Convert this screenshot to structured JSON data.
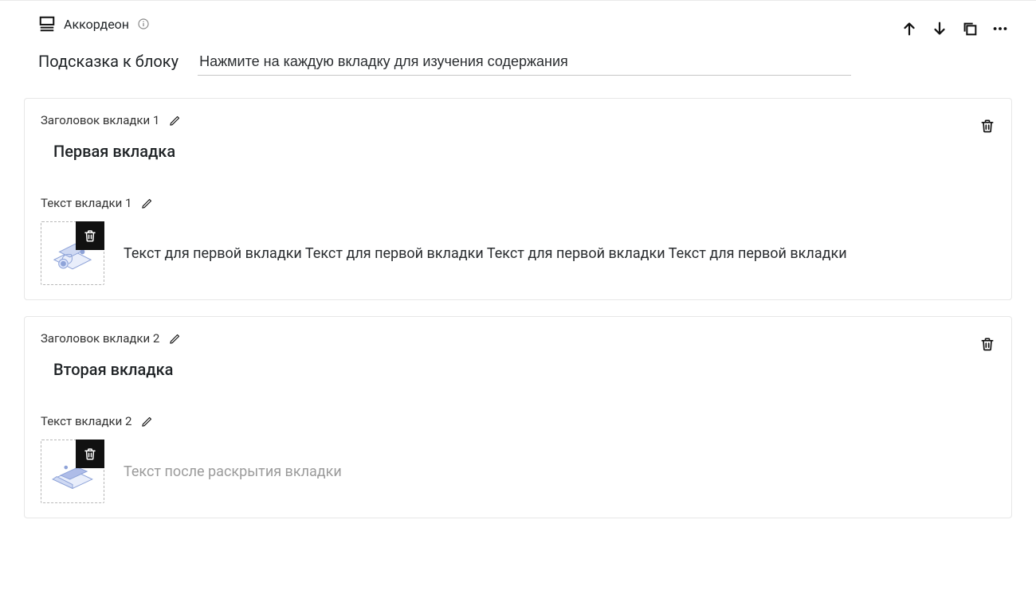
{
  "block": {
    "type_label": "Аккордеон",
    "hint_label": "Подсказка к блоку",
    "hint_value": "Нажмите на каждую вкладку для изучения содержания"
  },
  "tabs": [
    {
      "header_label": "Заголовок вкладки 1",
      "title": "Первая вкладка",
      "text_label": "Текст вкладки 1",
      "body": "Текст для первой вкладки Текст для первой вкладки Текст для первой вкладки Текст для первой вкладки",
      "body_is_placeholder": false
    },
    {
      "header_label": "Заголовок вкладки 2",
      "title": "Вторая вкладка",
      "text_label": "Текст вкладки 2",
      "body": "Текст после раскрытия вкладки",
      "body_is_placeholder": true
    }
  ]
}
